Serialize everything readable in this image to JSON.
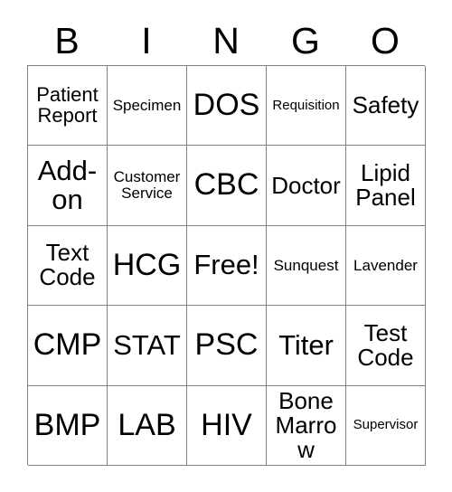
{
  "card": {
    "header_letters": [
      "B",
      "I",
      "N",
      "G",
      "O"
    ],
    "rows": [
      [
        {
          "label": "Patient Report",
          "size": "sm"
        },
        {
          "label": "Specimen",
          "size": "xs"
        },
        {
          "label": "DOS",
          "size": "xl"
        },
        {
          "label": "Requisition",
          "size": "xxs"
        },
        {
          "label": "Safety",
          "size": "md"
        }
      ],
      [
        {
          "label": "Add-on",
          "size": "lg"
        },
        {
          "label": "Customer Service",
          "size": "xs"
        },
        {
          "label": "CBC",
          "size": "xl"
        },
        {
          "label": "Doctor",
          "size": "md"
        },
        {
          "label": "Lipid Panel",
          "size": "md"
        }
      ],
      [
        {
          "label": "Text Code",
          "size": "md"
        },
        {
          "label": "HCG",
          "size": "xl"
        },
        {
          "label": "Free!",
          "size": "lg"
        },
        {
          "label": "Sunquest",
          "size": "xs"
        },
        {
          "label": "Lavender",
          "size": "xs"
        }
      ],
      [
        {
          "label": "CMP",
          "size": "xl"
        },
        {
          "label": "STAT",
          "size": "lg"
        },
        {
          "label": "PSC",
          "size": "xl"
        },
        {
          "label": "Titer",
          "size": "lg"
        },
        {
          "label": "Test Code",
          "size": "md"
        }
      ],
      [
        {
          "label": "BMP",
          "size": "xl"
        },
        {
          "label": "LAB",
          "size": "xl"
        },
        {
          "label": "HIV",
          "size": "xl"
        },
        {
          "label": "Bone Marrow",
          "size": "md"
        },
        {
          "label": "Supervisor",
          "size": "xxs"
        }
      ]
    ]
  },
  "colors": {
    "background": "#ffffff",
    "text": "#000000",
    "grid_line": "#808080"
  }
}
